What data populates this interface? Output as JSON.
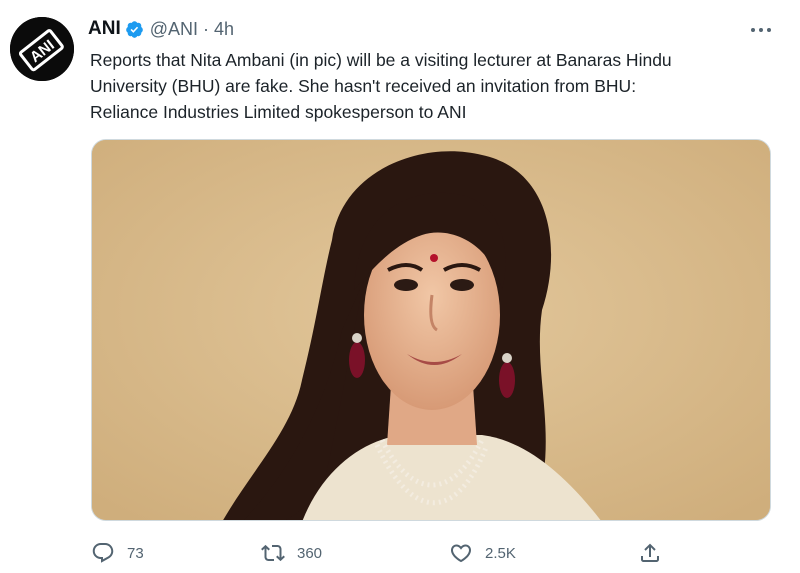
{
  "tweet": {
    "author_name": "ANI",
    "avatar_logo_text": "ANI",
    "handle": "@ANI",
    "separator": "·",
    "time": "4h",
    "text_lines": [
      "Reports that Nita Ambani (in pic) will be a visiting lecturer at Banaras Hindu",
      "University (BHU) are fake. She hasn't received an invitation from BHU:",
      "Reliance Industries Limited spokesperson to ANI"
    ],
    "media": {
      "background": "#d9bb8c"
    }
  },
  "actions": {
    "reply_count": "73",
    "retweet_count": "360",
    "like_count": "2.5K"
  },
  "colors": {
    "text": "#0f1419",
    "secondary": "#536471",
    "verified": "#1d9bf0"
  },
  "icons": [
    "avatar-logo",
    "verified-badge-icon",
    "more-icon",
    "reply-icon",
    "retweet-icon",
    "like-icon",
    "share-icon"
  ]
}
